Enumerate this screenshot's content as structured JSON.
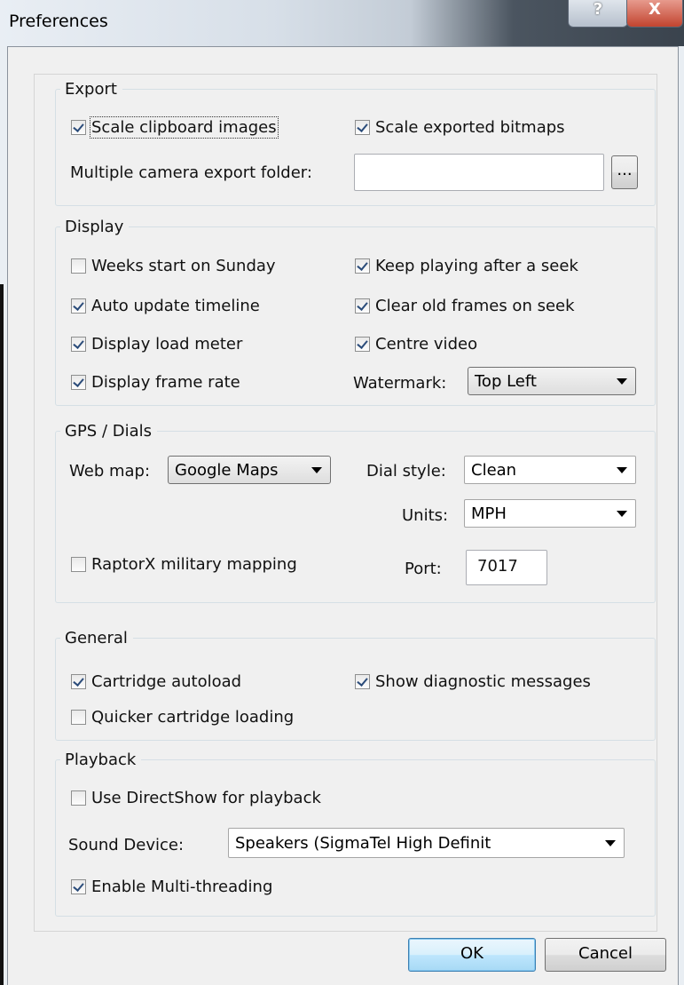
{
  "window": {
    "title": "Preferences",
    "help_label": "?",
    "close_label": "X"
  },
  "export": {
    "legend": "Export",
    "scale_clipboard": {
      "label": "Scale clipboard images",
      "checked": true
    },
    "scale_bitmaps": {
      "label": "Scale exported bitmaps",
      "checked": true
    },
    "folder_label": "Multiple camera export folder:",
    "folder_value": "",
    "browse_label": "..."
  },
  "display": {
    "legend": "Display",
    "weeks_sunday": {
      "label": "Weeks start on Sunday",
      "checked": false
    },
    "keep_playing": {
      "label": "Keep playing after a seek",
      "checked": true
    },
    "auto_update": {
      "label": "Auto update timeline",
      "checked": true
    },
    "clear_frames": {
      "label": "Clear old frames on seek",
      "checked": true
    },
    "load_meter": {
      "label": "Display load meter",
      "checked": true
    },
    "centre_video": {
      "label": "Centre video",
      "checked": true
    },
    "frame_rate": {
      "label": "Display frame rate",
      "checked": true
    },
    "watermark_label": "Watermark:",
    "watermark_value": "Top Left"
  },
  "gps": {
    "legend": "GPS / Dials",
    "web_map_label": "Web map:",
    "web_map_value": "Google Maps",
    "dial_style_label": "Dial style:",
    "dial_style_value": "Clean",
    "units_label": "Units:",
    "units_value": "MPH",
    "raptorx": {
      "label": "RaptorX military mapping",
      "checked": false
    },
    "port_label": "Port:",
    "port_value": "7017"
  },
  "general": {
    "legend": "General",
    "cartridge_autoload": {
      "label": "Cartridge autoload",
      "checked": true
    },
    "show_diagnostic": {
      "label": "Show diagnostic messages",
      "checked": true
    },
    "quicker_loading": {
      "label": "Quicker cartridge loading",
      "checked": false
    }
  },
  "playback": {
    "legend": "Playback",
    "directshow": {
      "label": "Use DirectShow for playback",
      "checked": false
    },
    "sound_device_label": "Sound Device:",
    "sound_device_value": "Speakers (SigmaTel High Definit",
    "multithreading": {
      "label": "Enable Multi-threading",
      "checked": true
    }
  },
  "buttons": {
    "ok": "OK",
    "cancel": "Cancel"
  }
}
